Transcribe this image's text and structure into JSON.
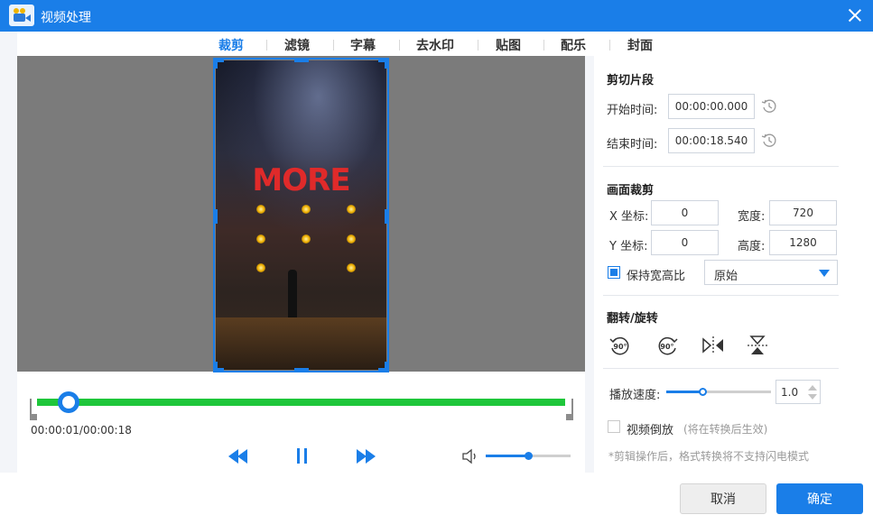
{
  "window": {
    "title": "视频处理"
  },
  "tabs": [
    "裁剪",
    "滤镜",
    "字幕",
    "去水印",
    "贴图",
    "配乐",
    "封面"
  ],
  "active_tab": "裁剪",
  "video": {
    "overlay_text": "MORE"
  },
  "timeline": {
    "timecode": "00:00:01/00:00:18",
    "position_fraction": 0.06
  },
  "player": {
    "volume_fraction": 0.5
  },
  "trim": {
    "title": "剪切片段",
    "start_label": "开始时间:",
    "start_value": "00:00:00.000",
    "end_label": "结束时间:",
    "end_value": "00:00:18.540"
  },
  "crop": {
    "title": "画面裁剪",
    "x_label": "X 坐标:",
    "x_value": "0",
    "y_label": "Y 坐标:",
    "y_value": "0",
    "width_label": "宽度:",
    "width_value": "720",
    "height_label": "高度:",
    "height_value": "1280",
    "keep_ratio_label": "保持宽高比",
    "keep_ratio_checked": true,
    "ratio_selected": "原始"
  },
  "flip": {
    "title": "翻转/旋转",
    "rotate_label": "90°"
  },
  "speed": {
    "label": "播放速度:",
    "value": "1.0",
    "slider_fraction": 0.35
  },
  "reverse": {
    "label": "视频倒放",
    "note": "(将在转换后生效)",
    "checked": false
  },
  "footnote": "*剪辑操作后，格式转换将不支持闪电模式",
  "buttons": {
    "cancel": "取消",
    "ok": "确定"
  },
  "colors": {
    "accent": "#1a7ee8",
    "timeline": "#1ec63a"
  }
}
